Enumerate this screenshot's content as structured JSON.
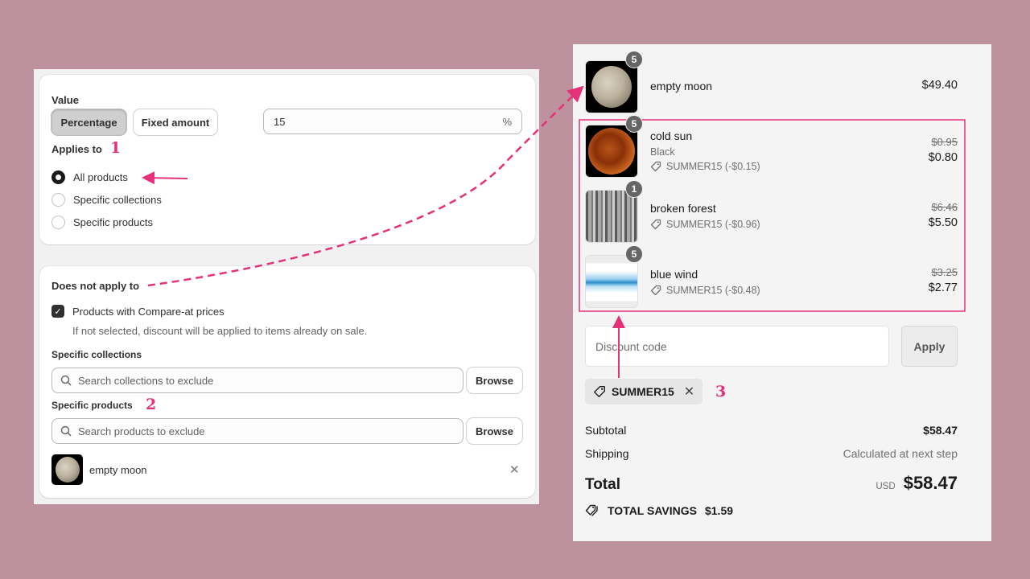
{
  "admin": {
    "value_section": {
      "heading": "Value",
      "type_options": [
        {
          "label": "Percentage",
          "selected": true
        },
        {
          "label": "Fixed amount",
          "selected": false
        }
      ],
      "amount": "15",
      "amount_suffix": "%"
    },
    "applies_to": {
      "heading": "Applies to",
      "options": [
        {
          "label": "All products",
          "selected": true
        },
        {
          "label": "Specific collections",
          "selected": false
        },
        {
          "label": "Specific products",
          "selected": false
        }
      ]
    },
    "excludes": {
      "heading": "Does not apply to",
      "compare_at_checkbox": {
        "label": "Products with Compare-at prices",
        "checked": true
      },
      "compare_at_help": "If not selected, discount will be applied to items already on sale.",
      "collections_label": "Specific collections",
      "collections_placeholder": "Search collections to exclude",
      "products_label": "Specific products",
      "products_placeholder": "Search products to exclude",
      "browse_label": "Browse",
      "excluded_products": [
        {
          "name": "empty moon"
        }
      ]
    }
  },
  "annotations": {
    "step1": "1",
    "step2": "2",
    "step3": "3",
    "accent_color": "#e5307a"
  },
  "checkout": {
    "line_items": [
      {
        "name": "empty moon",
        "quantity": "5",
        "price": "$49.40"
      },
      {
        "name": "cold sun",
        "quantity": "5",
        "variant": "Black",
        "discount": "SUMMER15 (-$0.15)",
        "original_price": "$0.95",
        "price": "$0.80"
      },
      {
        "name": "broken forest",
        "quantity": "1",
        "discount": "SUMMER15 (-$0.96)",
        "original_price": "$6.46",
        "price": "$5.50"
      },
      {
        "name": "blue wind",
        "quantity": "5",
        "discount": "SUMMER15 (-$0.48)",
        "original_price": "$3.25",
        "price": "$2.77"
      }
    ],
    "discount_placeholder": "Discount code",
    "apply_label": "Apply",
    "applied_code": "SUMMER15",
    "subtotal_label": "Subtotal",
    "subtotal": "$58.47",
    "shipping_label": "Shipping",
    "shipping": "Calculated at next step",
    "total_label": "Total",
    "currency": "USD",
    "total": "$58.47",
    "savings_label": "TOTAL SAVINGS",
    "savings": "$1.59"
  }
}
